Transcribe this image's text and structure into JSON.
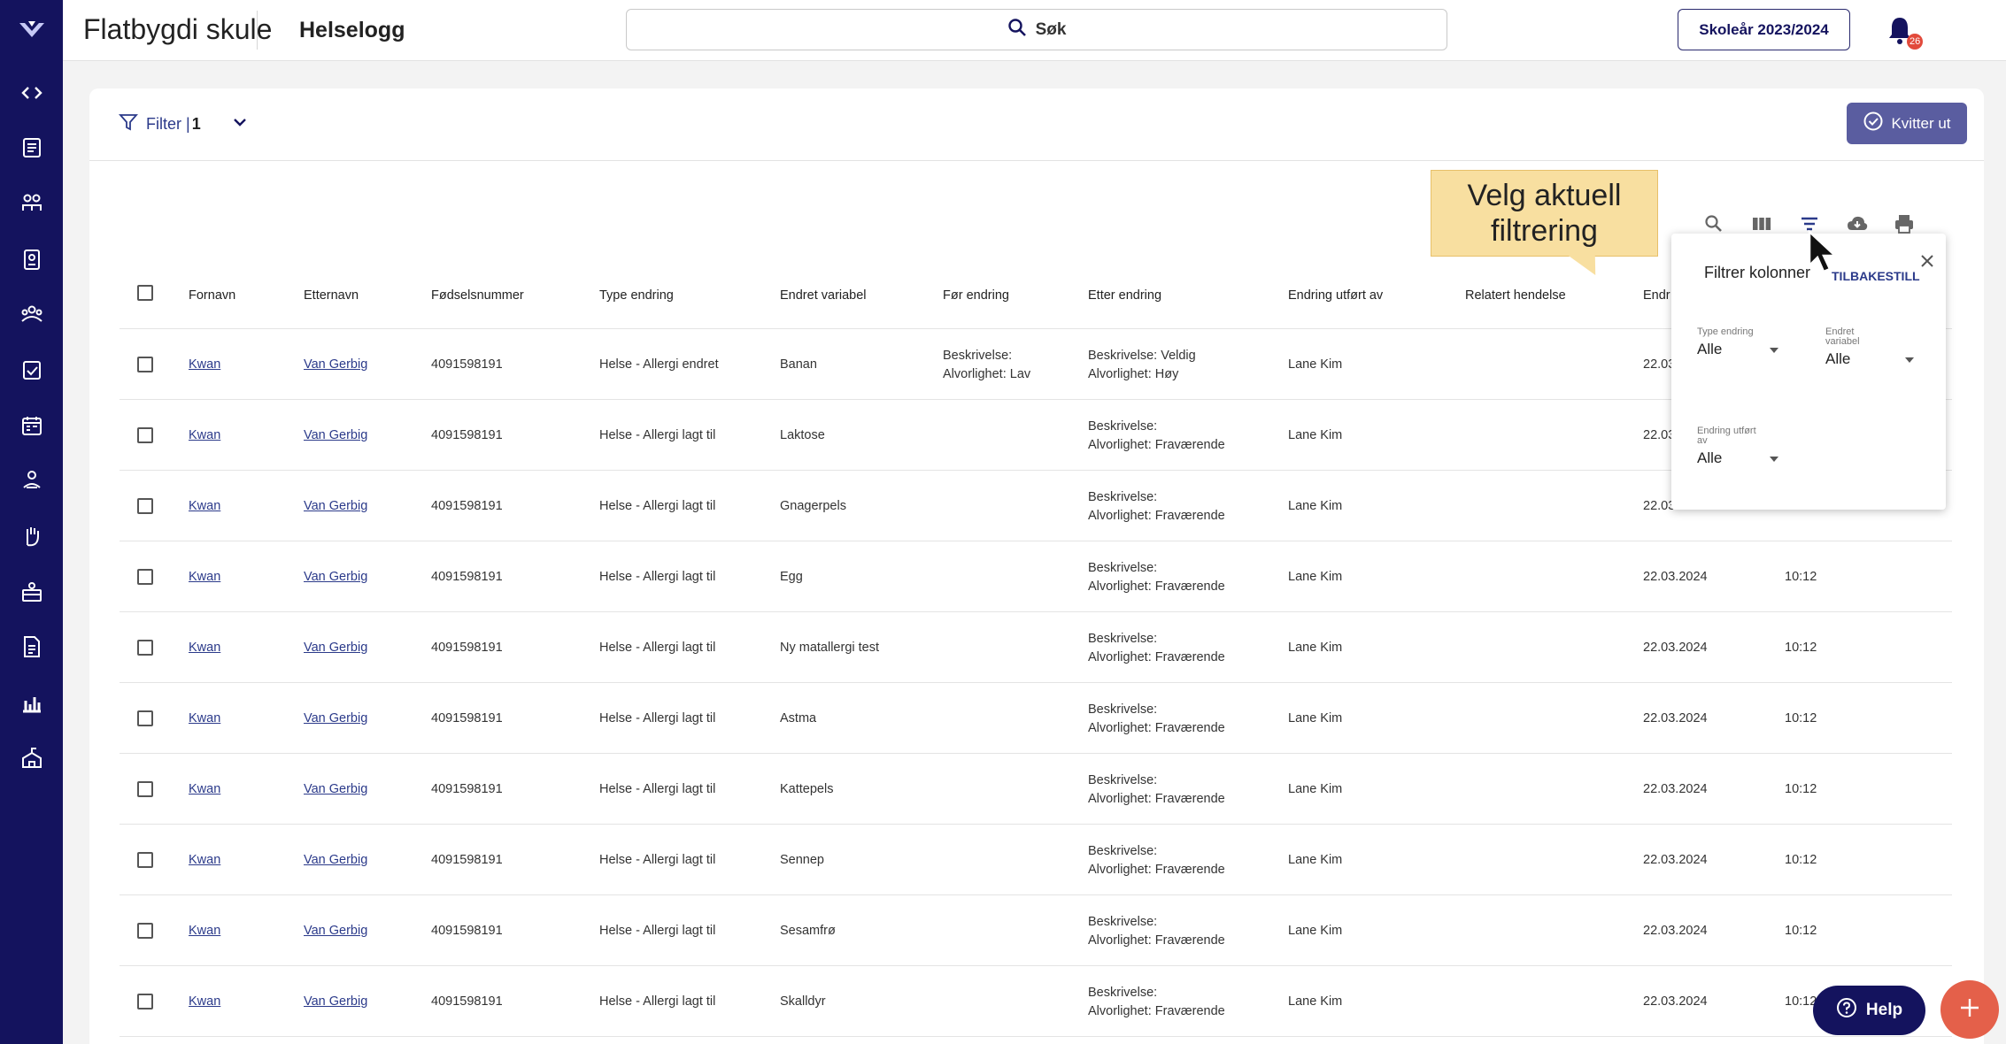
{
  "header": {
    "school_name": "Flatbygdi skule",
    "page_title": "Helselogg",
    "search_label": "Søk",
    "school_year": "Skoleår 2023/2024",
    "notification_count": "26"
  },
  "sidebar": {
    "items": [
      "code-toggle-icon",
      "document-list-icon",
      "groups-icon",
      "badge-icon",
      "people-icon",
      "assignment-icon",
      "calendar-icon",
      "health-icon",
      "raised-hand-icon",
      "inbox-icon",
      "report-icon",
      "chart-icon",
      "school-icon"
    ]
  },
  "filter": {
    "label": "Filter |",
    "count": "1"
  },
  "kvitter_button": "Kvitter ut",
  "callout_text": "Velg aktuell filtrering",
  "table": {
    "columns": [
      "Fornavn",
      "Etternavn",
      "Fødselsnummer",
      "Type endring",
      "Endret variabel",
      "Før endring",
      "Etter endring",
      "Endring utført av",
      "Relatert hendelse",
      "Endr"
    ],
    "rows": [
      {
        "fornavn": "Kwan",
        "etternavn": "Van Gerbig",
        "fnr": "4091598191",
        "type": "Helse - Allergi endret",
        "variabel": "Banan",
        "for_1": "Beskrivelse:",
        "for_2": "Alvorlighet: Lav",
        "etter_1": "Beskrivelse: Veldig",
        "etter_2": "Alvorlighet: Høy",
        "av": "Lane Kim",
        "dato": "22.03",
        "tid": ""
      },
      {
        "fornavn": "Kwan",
        "etternavn": "Van Gerbig",
        "fnr": "4091598191",
        "type": "Helse - Allergi lagt til",
        "variabel": "Laktose",
        "for_1": "",
        "for_2": "",
        "etter_1": "Beskrivelse:",
        "etter_2": "Alvorlighet: Fraværende",
        "av": "Lane Kim",
        "dato": "22.03",
        "tid": ""
      },
      {
        "fornavn": "Kwan",
        "etternavn": "Van Gerbig",
        "fnr": "4091598191",
        "type": "Helse - Allergi lagt til",
        "variabel": "Gnagerpels",
        "for_1": "",
        "for_2": "",
        "etter_1": "Beskrivelse:",
        "etter_2": "Alvorlighet: Fraværende",
        "av": "Lane Kim",
        "dato": "22.03.",
        "tid": ""
      },
      {
        "fornavn": "Kwan",
        "etternavn": "Van Gerbig",
        "fnr": "4091598191",
        "type": "Helse - Allergi lagt til",
        "variabel": "Egg",
        "for_1": "",
        "for_2": "",
        "etter_1": "Beskrivelse:",
        "etter_2": "Alvorlighet: Fraværende",
        "av": "Lane Kim",
        "dato": "22.03.2024",
        "tid": "10:12"
      },
      {
        "fornavn": "Kwan",
        "etternavn": "Van Gerbig",
        "fnr": "4091598191",
        "type": "Helse - Allergi lagt til",
        "variabel": "Ny matallergi test",
        "for_1": "",
        "for_2": "",
        "etter_1": "Beskrivelse:",
        "etter_2": "Alvorlighet: Fraværende",
        "av": "Lane Kim",
        "dato": "22.03.2024",
        "tid": "10:12"
      },
      {
        "fornavn": "Kwan",
        "etternavn": "Van Gerbig",
        "fnr": "4091598191",
        "type": "Helse - Allergi lagt til",
        "variabel": "Astma",
        "for_1": "",
        "for_2": "",
        "etter_1": "Beskrivelse:",
        "etter_2": "Alvorlighet: Fraværende",
        "av": "Lane Kim",
        "dato": "22.03.2024",
        "tid": "10:12"
      },
      {
        "fornavn": "Kwan",
        "etternavn": "Van Gerbig",
        "fnr": "4091598191",
        "type": "Helse - Allergi lagt til",
        "variabel": "Kattepels",
        "for_1": "",
        "for_2": "",
        "etter_1": "Beskrivelse:",
        "etter_2": "Alvorlighet: Fraværende",
        "av": "Lane Kim",
        "dato": "22.03.2024",
        "tid": "10:12"
      },
      {
        "fornavn": "Kwan",
        "etternavn": "Van Gerbig",
        "fnr": "4091598191",
        "type": "Helse - Allergi lagt til",
        "variabel": "Sennep",
        "for_1": "",
        "for_2": "",
        "etter_1": "Beskrivelse:",
        "etter_2": "Alvorlighet: Fraværende",
        "av": "Lane Kim",
        "dato": "22.03.2024",
        "tid": "10:12"
      },
      {
        "fornavn": "Kwan",
        "etternavn": "Van Gerbig",
        "fnr": "4091598191",
        "type": "Helse - Allergi lagt til",
        "variabel": "Sesamfrø",
        "for_1": "",
        "for_2": "",
        "etter_1": "Beskrivelse:",
        "etter_2": "Alvorlighet: Fraværende",
        "av": "Lane Kim",
        "dato": "22.03.2024",
        "tid": "10:12"
      },
      {
        "fornavn": "Kwan",
        "etternavn": "Van Gerbig",
        "fnr": "4091598191",
        "type": "Helse - Allergi lagt til",
        "variabel": "Skalldyr",
        "for_1": "",
        "for_2": "",
        "etter_1": "Beskrivelse:",
        "etter_2": "Alvorlighet: Fraværende",
        "av": "Lane Kim",
        "dato": "22.03.2024",
        "tid": "10:12"
      }
    ]
  },
  "filter_popup": {
    "title": "Filtrer kolonner",
    "reset_label": "TILBAKESTILL",
    "fields": [
      {
        "label": "Type endring",
        "value": "Alle"
      },
      {
        "label": "Endret variabel",
        "value": "Alle"
      },
      {
        "label": "Endring utført av",
        "value": "Alle"
      }
    ]
  },
  "help_button": "Help",
  "colors": {
    "sidebar": "#14135e",
    "accent": "#2b3a8a",
    "kvitter": "#5a5da0",
    "callout": "#f8dfa0",
    "fab": "#e4604a"
  }
}
